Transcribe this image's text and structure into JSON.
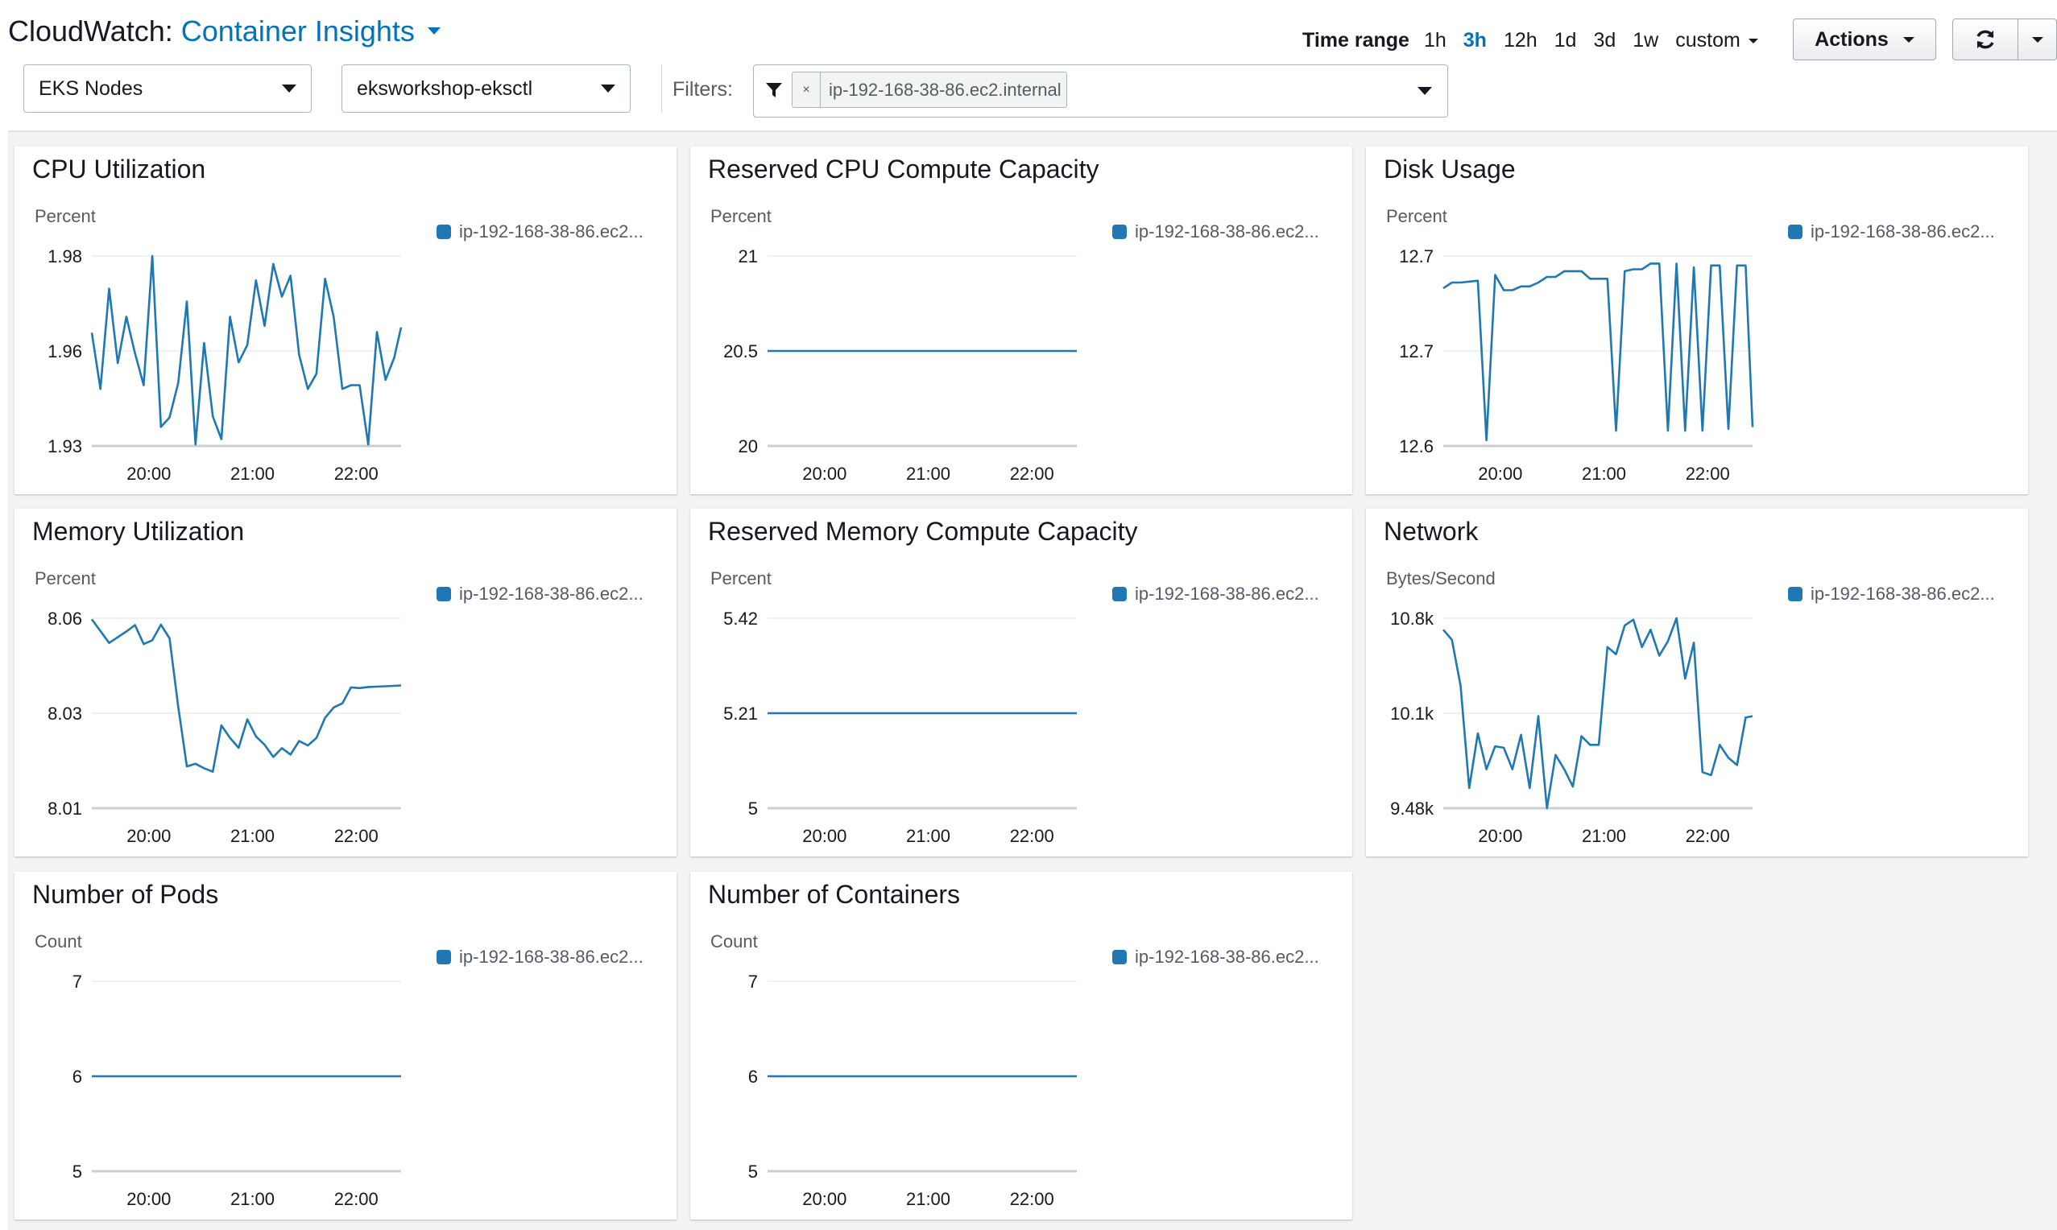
{
  "header": {
    "service": "CloudWatch:",
    "dashboard": "Container Insights",
    "time_range_label": "Time range",
    "time_options": [
      "1h",
      "3h",
      "12h",
      "1d",
      "3d",
      "1w"
    ],
    "time_active": "3h",
    "custom_label": "custom",
    "actions_label": "Actions"
  },
  "filters": {
    "resource_type": "EKS Nodes",
    "cluster": "eksworkshop-eksctl",
    "label": "Filters:",
    "token": "ip-192-168-38-86.ec2.internal"
  },
  "colors": {
    "series": "#1f77b4",
    "accent": "#0073bb"
  },
  "icons": {
    "funnel": "funnel-icon",
    "refresh": "refresh-icon"
  },
  "widgets": [
    {
      "id": "cpu",
      "title": "CPU Utilization",
      "unit": "Percent",
      "legend": "ip-192-168-38-86.ec2...",
      "chart_data": {
        "type": "line",
        "x_ticks": [
          "20:00",
          "21:00",
          "22:00"
        ],
        "x_range": [
          "19:27",
          "22:26"
        ],
        "y_ticks": [
          "1.98",
          "1.96",
          "1.93"
        ],
        "ylim": [
          1.93,
          1.98
        ],
        "series": [
          {
            "name": "ip-192-168-38-86.ec2...",
            "x": [
              "19:27",
              "19:32",
              "19:37",
              "19:42",
              "19:47",
              "19:52",
              "19:57",
              "20:02",
              "20:07",
              "20:12",
              "20:17",
              "20:22",
              "20:27",
              "20:32",
              "20:37",
              "20:42",
              "20:47",
              "20:52",
              "20:57",
              "21:02",
              "21:07",
              "21:12",
              "21:17",
              "21:22",
              "21:27",
              "21:32",
              "21:37",
              "21:42",
              "21:47",
              "21:52",
              "21:57",
              "22:02",
              "22:07",
              "22:12",
              "22:17",
              "22:22",
              "22:26"
            ],
            "values": [
              1.9598,
              1.945,
              1.9714,
              1.9518,
              1.964,
              1.9544,
              1.946,
              1.98,
              1.935,
              1.9375,
              1.9466,
              1.968,
              1.9304,
              1.9571,
              1.9378,
              1.9318,
              1.964,
              1.952,
              1.9566,
              1.9736,
              1.9616,
              1.9779,
              1.9693,
              1.9748,
              1.954,
              1.945,
              1.949,
              1.974,
              1.964,
              1.945,
              1.946,
              1.946,
              1.9304,
              1.96,
              1.9474,
              1.9532,
              1.9612
            ]
          }
        ]
      }
    },
    {
      "id": "rcpu",
      "title": "Reserved CPU Compute Capacity",
      "unit": "Percent",
      "legend": "ip-192-168-38-86.ec2...",
      "chart_data": {
        "type": "line",
        "x_ticks": [
          "20:00",
          "21:00",
          "22:00"
        ],
        "x_range": [
          "19:27",
          "22:26"
        ],
        "y_ticks": [
          "21",
          "20.5",
          "20"
        ],
        "ylim": [
          20,
          21
        ],
        "series": [
          {
            "name": "ip-192-168-38-86.ec2...",
            "x": [
              "19:27",
              "22:26"
            ],
            "values": [
              20.5,
              20.5
            ]
          }
        ]
      }
    },
    {
      "id": "disk",
      "title": "Disk Usage",
      "unit": "Percent",
      "legend": "ip-192-168-38-86.ec2...",
      "chart_data": {
        "type": "line",
        "x_ticks": [
          "20:00",
          "21:00",
          "22:00"
        ],
        "x_range": [
          "19:27",
          "22:26"
        ],
        "y_ticks": [
          "12.7",
          "12.7",
          "12.6"
        ],
        "ylim": [
          12.6,
          12.7
        ],
        "series": [
          {
            "name": "ip-192-168-38-86.ec2...",
            "x": [
              "19:27",
              "19:32",
              "19:37",
              "19:47",
              "19:52",
              "19:57",
              "20:02",
              "20:07",
              "20:12",
              "20:17",
              "20:22",
              "20:27",
              "20:32",
              "20:37",
              "20:42",
              "20:47",
              "20:52",
              "20:57",
              "21:02",
              "21:07",
              "21:12",
              "21:17",
              "21:22",
              "21:27",
              "21:32",
              "21:37",
              "21:42",
              "21:47",
              "21:52",
              "21:57",
              "22:02",
              "22:07",
              "22:12",
              "22:17",
              "22:22",
              "22:26"
            ],
            "values": [
              12.683,
              12.686,
              12.686,
              12.687,
              12.603,
              12.69,
              12.682,
              12.682,
              12.684,
              12.684,
              12.686,
              12.689,
              12.689,
              12.692,
              12.692,
              12.692,
              12.688,
              12.688,
              12.688,
              12.608,
              12.692,
              12.693,
              12.693,
              12.696,
              12.696,
              12.608,
              12.696,
              12.608,
              12.694,
              12.608,
              12.695,
              12.695,
              12.609,
              12.695,
              12.695,
              12.61
            ]
          }
        ]
      }
    },
    {
      "id": "mem",
      "title": "Memory Utilization",
      "unit": "Percent",
      "legend": "ip-192-168-38-86.ec2...",
      "chart_data": {
        "type": "line",
        "x_ticks": [
          "20:00",
          "21:00",
          "22:00"
        ],
        "x_range": [
          "19:27",
          "22:26"
        ],
        "y_ticks": [
          "8.06",
          "8.03",
          "8.01"
        ],
        "ylim": [
          8.01,
          8.06
        ],
        "series": [
          {
            "name": "ip-192-168-38-86.ec2...",
            "x": [
              "19:27",
              "19:37",
              "19:47",
              "19:52",
              "19:57",
              "20:02",
              "20:07",
              "20:12",
              "20:17",
              "20:22",
              "20:27",
              "20:32",
              "20:37",
              "20:42",
              "20:47",
              "20:52",
              "20:57",
              "21:02",
              "21:07",
              "21:12",
              "21:17",
              "21:22",
              "21:27",
              "21:32",
              "21:37",
              "21:42",
              "21:47",
              "21:52",
              "21:57",
              "22:02",
              "22:07",
              "22:12",
              "22:17",
              "22:22",
              "22:26"
            ],
            "values": [
              8.0597,
              8.0535,
              8.0565,
              8.0582,
              8.0532,
              8.0542,
              8.0583,
              8.0547,
              8.0367,
              8.021,
              8.0217,
              8.0205,
              8.0196,
              8.0318,
              8.0285,
              8.0259,
              8.0334,
              8.0289,
              8.0267,
              8.0235,
              8.0258,
              8.0241,
              8.0277,
              8.0265,
              8.0285,
              8.0338,
              8.0365,
              8.0376,
              8.0418,
              8.0416,
              8.0419,
              8.042,
              8.0421,
              8.0422,
              8.0423
            ]
          }
        ]
      }
    },
    {
      "id": "rmem",
      "title": "Reserved Memory Compute Capacity",
      "unit": "Percent",
      "legend": "ip-192-168-38-86.ec2...",
      "chart_data": {
        "type": "line",
        "x_ticks": [
          "20:00",
          "21:00",
          "22:00"
        ],
        "x_range": [
          "19:27",
          "22:26"
        ],
        "y_ticks": [
          "5.42",
          "5.21",
          "5"
        ],
        "ylim": [
          5,
          5.42
        ],
        "series": [
          {
            "name": "ip-192-168-38-86.ec2...",
            "x": [
              "19:27",
              "22:26"
            ],
            "values": [
              5.21,
              5.21
            ]
          }
        ]
      }
    },
    {
      "id": "net",
      "title": "Network",
      "unit": "Bytes/Second",
      "legend": "ip-192-168-38-86.ec2...",
      "chart_data": {
        "type": "line",
        "x_ticks": [
          "20:00",
          "21:00",
          "22:00"
        ],
        "x_range": [
          "19:27",
          "22:26"
        ],
        "y_ticks": [
          "10.8k",
          "10.1k",
          "9.48k"
        ],
        "ylim": [
          9480,
          10800
        ],
        "series": [
          {
            "name": "ip-192-168-38-86.ec2...",
            "x": [
              "19:27",
              "19:32",
              "19:37",
              "19:42",
              "19:47",
              "19:52",
              "19:57",
              "20:02",
              "20:07",
              "20:12",
              "20:17",
              "20:22",
              "20:27",
              "20:32",
              "20:37",
              "20:42",
              "20:47",
              "20:52",
              "20:57",
              "21:02",
              "21:07",
              "21:12",
              "21:17",
              "21:22",
              "21:27",
              "21:32",
              "21:37",
              "21:42",
              "21:47",
              "21:52",
              "21:57",
              "22:02",
              "22:07",
              "22:12",
              "22:17",
              "22:22",
              "22:26"
            ],
            "values": [
              10720,
              10650,
              10330,
              9620,
              10000,
              9750,
              9910,
              9900,
              9750,
              9990,
              9620,
              10120,
              9480,
              9850,
              9750,
              9630,
              9980,
              9920,
              9920,
              10600,
              10550,
              10750,
              10790,
              10600,
              10720,
              10540,
              10640,
              10800,
              10380,
              10630,
              9730,
              9710,
              9920,
              9830,
              9780,
              10110,
              10120
            ]
          }
        ]
      }
    },
    {
      "id": "pods",
      "title": "Number of Pods",
      "unit": "Count",
      "legend": "ip-192-168-38-86.ec2...",
      "chart_data": {
        "type": "line",
        "x_ticks": [
          "20:00",
          "21:00",
          "22:00"
        ],
        "x_range": [
          "19:27",
          "22:26"
        ],
        "y_ticks": [
          "7",
          "6",
          "5"
        ],
        "ylim": [
          5,
          7
        ],
        "series": [
          {
            "name": "ip-192-168-38-86.ec2...",
            "x": [
              "19:27",
              "22:26"
            ],
            "values": [
              6,
              6
            ]
          }
        ]
      }
    },
    {
      "id": "cont",
      "title": "Number of Containers",
      "unit": "Count",
      "legend": "ip-192-168-38-86.ec2...",
      "chart_data": {
        "type": "line",
        "x_ticks": [
          "20:00",
          "21:00",
          "22:00"
        ],
        "x_range": [
          "19:27",
          "22:26"
        ],
        "y_ticks": [
          "7",
          "6",
          "5"
        ],
        "ylim": [
          5,
          7
        ],
        "series": [
          {
            "name": "ip-192-168-38-86.ec2...",
            "x": [
              "19:27",
              "22:26"
            ],
            "values": [
              6,
              6
            ]
          }
        ]
      }
    }
  ]
}
